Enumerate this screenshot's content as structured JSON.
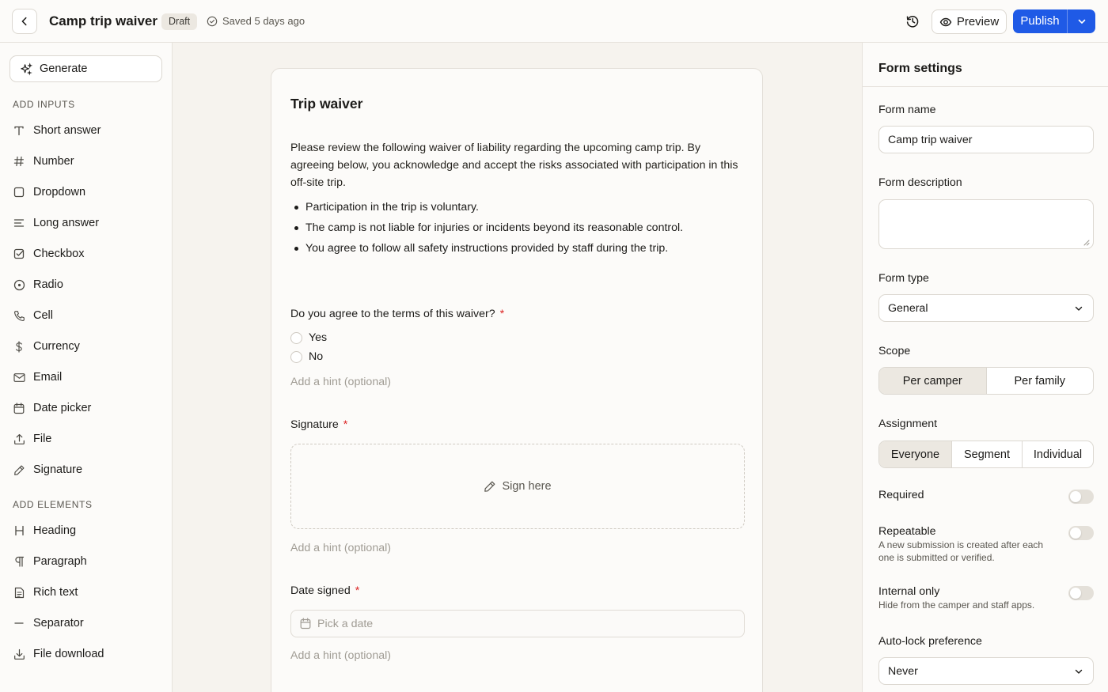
{
  "header": {
    "title": "Camp trip waiver",
    "status_badge": "Draft",
    "saved_text": "Saved 5 days ago",
    "preview_label": "Preview",
    "publish_label": "Publish",
    "accent_color": "#1f5ae6"
  },
  "sidebar": {
    "generate_label": "Generate",
    "inputs_heading": "ADD INPUTS",
    "inputs": [
      {
        "label": "Short answer",
        "icon": "text-t-icon"
      },
      {
        "label": "Number",
        "icon": "hash-icon"
      },
      {
        "label": "Dropdown",
        "icon": "square-icon"
      },
      {
        "label": "Long answer",
        "icon": "lines-icon"
      },
      {
        "label": "Checkbox",
        "icon": "checkbox-icon"
      },
      {
        "label": "Radio",
        "icon": "radio-icon"
      },
      {
        "label": "Cell",
        "icon": "phone-icon"
      },
      {
        "label": "Currency",
        "icon": "dollar-icon"
      },
      {
        "label": "Email",
        "icon": "mail-icon"
      },
      {
        "label": "Date picker",
        "icon": "calendar-icon"
      },
      {
        "label": "File",
        "icon": "upload-icon"
      },
      {
        "label": "Signature",
        "icon": "pen-icon"
      }
    ],
    "elements_heading": "ADD ELEMENTS",
    "elements": [
      {
        "label": "Heading",
        "icon": "heading-icon"
      },
      {
        "label": "Paragraph",
        "icon": "pilcrow-icon"
      },
      {
        "label": "Rich text",
        "icon": "document-icon"
      },
      {
        "label": "Separator",
        "icon": "minus-icon"
      },
      {
        "label": "File download",
        "icon": "download-icon"
      }
    ]
  },
  "form": {
    "title": "Trip waiver",
    "description": "Please review the following waiver of liability regarding the upcoming camp trip. By agreeing below, you acknowledge and accept the risks associated with participation in this off-site trip.",
    "bullets": [
      "Participation in the trip is voluntary.",
      "The camp is not liable for injuries or incidents beyond its reasonable control.",
      "You agree to follow all safety instructions provided by staff during the trip."
    ],
    "required_mark": "*",
    "agree_question": "Do you agree to the terms of this waiver?",
    "agree_options": [
      "Yes",
      "No"
    ],
    "hint_placeholder": "Add a hint (optional)",
    "signature_label": "Signature",
    "signature_prompt": "Sign here",
    "date_label": "Date signed",
    "date_placeholder": "Pick a date"
  },
  "settings": {
    "title": "Form settings",
    "form_name_label": "Form name",
    "form_name_value": "Camp trip waiver",
    "form_description_label": "Form description",
    "form_description_value": "",
    "form_type_label": "Form type",
    "form_type_value": "General",
    "scope_label": "Scope",
    "scope_options": [
      "Per camper",
      "Per family"
    ],
    "scope_selected": "Per camper",
    "assignment_label": "Assignment",
    "assignment_options": [
      "Everyone",
      "Segment",
      "Individual"
    ],
    "assignment_selected": "Everyone",
    "required_label": "Required",
    "required_on": false,
    "repeatable_label": "Repeatable",
    "repeatable_desc": "A new submission is created after each one is submitted or verified.",
    "repeatable_on": false,
    "internal_label": "Internal only",
    "internal_desc": "Hide from the camper and staff apps.",
    "internal_on": false,
    "autolock_label": "Auto-lock preference",
    "autolock_value": "Never"
  }
}
